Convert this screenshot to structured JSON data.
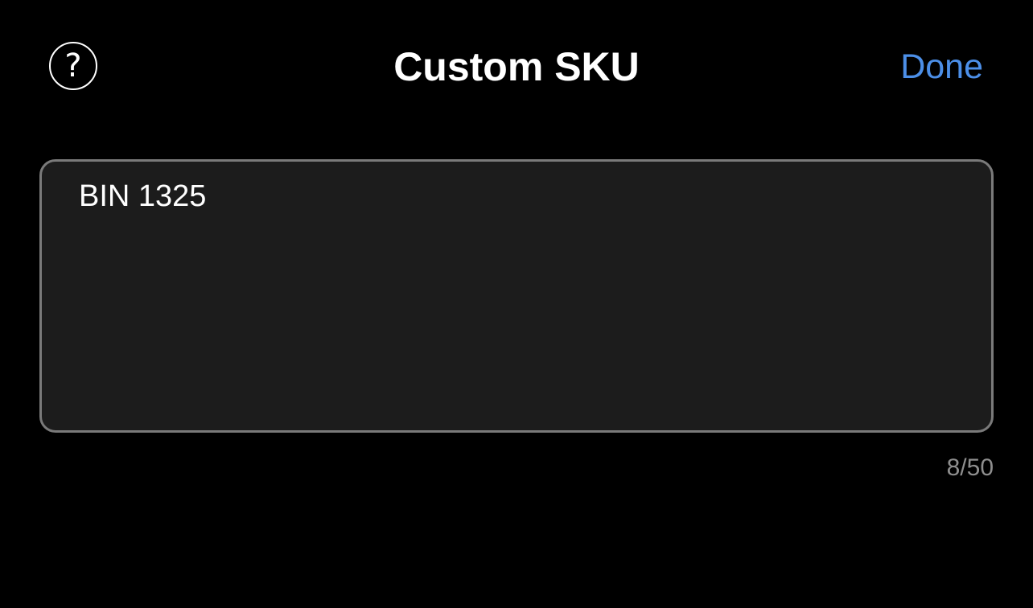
{
  "header": {
    "help_icon": "question-circle-icon",
    "help_glyph": "?",
    "title": "Custom SKU",
    "done_label": "Done"
  },
  "sku_field": {
    "value": "BIN 1325",
    "counter": "8/50"
  },
  "colors": {
    "background": "#000000",
    "accent": "#4c8fe8",
    "field_background": "#1c1c1c",
    "field_border": "#7a7a7a",
    "counter_text": "#8e8e8e"
  }
}
